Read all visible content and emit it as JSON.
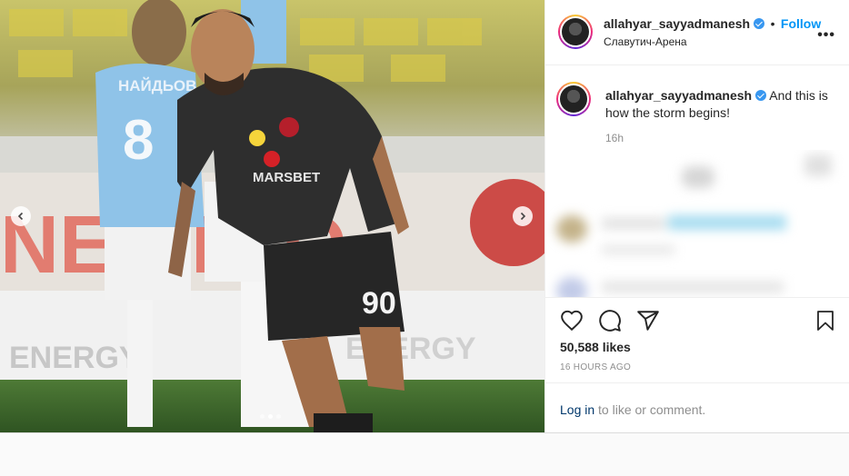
{
  "post": {
    "username": "allahyar_sayyadmanesh",
    "separator": "•",
    "follow_label": "Follow",
    "location": "Славутич-Арена",
    "more_label": "•••",
    "caption": "And this is how the storm begins!",
    "time_relative": "16h",
    "likes": "50,588 likes",
    "posted_ago": "16 HOURS AGO",
    "login_label": "Log in",
    "comment_prompt": " to like or comment."
  },
  "media": {
    "jersey_sponsor": "MARSBET",
    "jersey_number": "90",
    "opponent_name": "НАЙДЬОВ",
    "opponent_number": "8",
    "board_text": "ENERGY",
    "slide_index": 2,
    "slide_count": 3
  },
  "colors": {
    "accent": "#0095f6",
    "verified": "#3897f0",
    "link": "#00376b",
    "muted": "#8e8e8e"
  },
  "icons": [
    "heart-icon",
    "comment-icon",
    "share-icon",
    "bookmark-icon",
    "chevron-left-icon",
    "chevron-right-icon",
    "verified-badge-icon",
    "more-icon"
  ]
}
